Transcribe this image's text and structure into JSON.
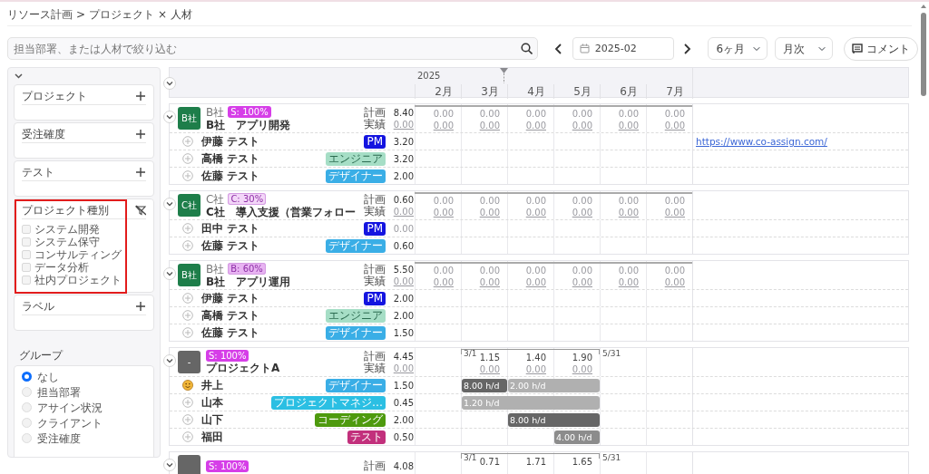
{
  "breadcrumb": {
    "items": [
      "リソース計画",
      "プロジェクト × 人材"
    ],
    "separator": ">"
  },
  "toolbar": {
    "search": {
      "placeholder": "担当部署、または人材で絞り込む"
    },
    "date": "2025-02",
    "range_select": "6ヶ月",
    "interval_select": "月次",
    "comment_button": "コメント"
  },
  "sidebar": {
    "filters": [
      {
        "kind": "add",
        "title": "プロジェクト",
        "highlighted": false
      },
      {
        "kind": "add",
        "title": "受注確度",
        "highlighted": false
      },
      {
        "kind": "add",
        "title": "テスト",
        "highlighted": false
      },
      {
        "kind": "checklist",
        "title": "プロジェクト種別",
        "highlighted": true,
        "options": [
          {
            "label": "システム開発",
            "checked": false
          },
          {
            "label": "システム保守",
            "checked": false
          },
          {
            "label": "コンサルティング",
            "checked": false
          },
          {
            "label": "データ分析",
            "checked": false
          },
          {
            "label": "社内プロジェクト",
            "checked": false
          }
        ]
      },
      {
        "kind": "add",
        "title": "ラベル",
        "highlighted": false
      }
    ],
    "group": {
      "label": "グループ",
      "options": [
        {
          "label": "なし",
          "selected": true
        },
        {
          "label": "担当部署",
          "selected": false
        },
        {
          "label": "アサイン状況",
          "selected": false
        },
        {
          "label": "クライアント",
          "selected": false
        },
        {
          "label": "受注確度",
          "selected": false
        }
      ]
    }
  },
  "timeline": {
    "year": "2025",
    "months": [
      "2月",
      "3月",
      "4月",
      "5月",
      "6月",
      "7月"
    ]
  },
  "projects": [
    {
      "avatar": "B社",
      "color": "#1e7e4a",
      "client": "B社",
      "badge": {
        "text": "S: 100%",
        "color": "#d63ee8"
      },
      "title": "B社　アプリ開発",
      "plan_label": "計画",
      "actual_label": "実績",
      "plan": "8.40",
      "actual": "0.00",
      "months": [
        {
          "kind": "value",
          "plan": "0.00",
          "actual": "0.00"
        },
        {
          "kind": "value",
          "plan": "0.00",
          "actual": "0.00"
        },
        {
          "kind": "value",
          "plan": "0.00",
          "actual": "0.00"
        },
        {
          "kind": "value",
          "plan": "0.00",
          "actual": "0.00"
        },
        {
          "kind": "value",
          "plan": "0.00",
          "actual": "0.00"
        },
        {
          "kind": "value",
          "plan": "0.00",
          "actual": "0.00"
        }
      ],
      "members": [
        {
          "kind": "add",
          "name": "伊藤 テスト",
          "role": {
            "text": "PM",
            "color": "#1414e0"
          },
          "total": "3.20",
          "link": "https://www.co-assign.com/"
        },
        {
          "kind": "add",
          "name": "高橋 テスト",
          "role": {
            "text": "エンジニア",
            "color": "#a6dec6"
          },
          "total": "3.20"
        },
        {
          "kind": "add",
          "name": "佐藤 テスト",
          "role": {
            "text": "デザイナー",
            "color": "#3aaee6"
          },
          "total": "2.00"
        }
      ]
    },
    {
      "avatar": "C社",
      "color": "#1e7e4a",
      "client": "C社",
      "badge": {
        "text": "C: 30%",
        "color": "#f3d6f8"
      },
      "title": "C社　導入支援（営業フォロー",
      "plan_label": "計画",
      "actual_label": "実績",
      "plan": "0.60",
      "actual": "0.00",
      "months": [
        {
          "kind": "value",
          "plan": "0.00",
          "actual": "0.00"
        },
        {
          "kind": "value",
          "plan": "0.00",
          "actual": "0.00"
        },
        {
          "kind": "value",
          "plan": "0.00",
          "actual": "0.00"
        },
        {
          "kind": "value",
          "plan": "0.00",
          "actual": "0.00"
        },
        {
          "kind": "value",
          "plan": "0.00",
          "actual": "0.00"
        },
        {
          "kind": "value",
          "plan": "0.00",
          "actual": "0.00"
        }
      ],
      "members": [
        {
          "kind": "add",
          "name": "田中 テスト",
          "role": {
            "text": "PM",
            "color": "#1414e0"
          },
          "total": "0.00"
        },
        {
          "kind": "add",
          "name": "佐藤 テスト",
          "role": {
            "text": "デザイナー",
            "color": "#3aaee6"
          },
          "total": "0.60"
        }
      ]
    },
    {
      "avatar": "B社",
      "color": "#1e7e4a",
      "client": "B社",
      "badge": {
        "text": "B: 60%",
        "color": "#e8b4f2"
      },
      "title": "B社　アプリ運用",
      "plan_label": "計画",
      "actual_label": "実績",
      "plan": "5.50",
      "actual": "0.00",
      "months": [
        {
          "kind": "value",
          "plan": "0.00",
          "actual": "0.00"
        },
        {
          "kind": "value",
          "plan": "0.00",
          "actual": "0.00"
        },
        {
          "kind": "value",
          "plan": "0.00",
          "actual": "0.00"
        },
        {
          "kind": "value",
          "plan": "0.00",
          "actual": "0.00"
        },
        {
          "kind": "value",
          "plan": "0.00",
          "actual": "0.00"
        },
        {
          "kind": "value",
          "plan": "0.00",
          "actual": "0.00"
        }
      ],
      "members": [
        {
          "kind": "add",
          "name": "伊藤 テスト",
          "role": {
            "text": "PM",
            "color": "#1414e0"
          },
          "total": "2.00"
        },
        {
          "kind": "add",
          "name": "高橋 テスト",
          "role": {
            "text": "エンジニア",
            "color": "#a6dec6"
          },
          "total": "2.00"
        },
        {
          "kind": "add",
          "name": "佐藤 テスト",
          "role": {
            "text": "デザイナー",
            "color": "#3aaee6"
          },
          "total": "1.50"
        }
      ]
    },
    {
      "avatar": "-",
      "color": "#666666",
      "badge": {
        "text": "S: 100%",
        "color": "#d63ee8"
      },
      "title": "プロジェクトA",
      "plan_label": "計画",
      "actual_label": "実績",
      "plan": "4.45",
      "actual": "0.00",
      "range": {
        "start_label": "3/1",
        "end_label": "5/31"
      },
      "months": [
        {
          "kind": "empty"
        },
        {
          "kind": "value",
          "plan": "1.15",
          "actual": "0.00"
        },
        {
          "kind": "value",
          "plan": "1.40",
          "actual": "0.00"
        },
        {
          "kind": "value",
          "plan": "1.90",
          "actual": "0.00"
        },
        {
          "kind": "empty"
        },
        {
          "kind": "empty"
        }
      ],
      "members": [
        {
          "kind": "smiley",
          "name": "井上",
          "role": {
            "text": "デザイナー",
            "color": "#3aaee6"
          },
          "total": "1.50",
          "cells": [
            {
              "kind": "empty"
            },
            {
              "kind": "bar",
              "text": "8.00 h/d",
              "color": "#666666"
            },
            {
              "kind": "bar",
              "text": "2.00 h/d",
              "color": "#b0b0b0"
            },
            {
              "kind": "continue"
            },
            {
              "kind": "empty"
            },
            {
              "kind": "empty"
            }
          ]
        },
        {
          "kind": "add",
          "name": "山本",
          "role": {
            "text": "プロジェクトマネジ…",
            "color": "#2bbfe3"
          },
          "total": "0.45",
          "cells": [
            {
              "kind": "empty"
            },
            {
              "kind": "bar",
              "text": "1.20 h/d",
              "color": "#b0b0b0"
            },
            {
              "kind": "continue"
            },
            {
              "kind": "continue"
            },
            {
              "kind": "empty"
            },
            {
              "kind": "empty"
            }
          ]
        },
        {
          "kind": "add",
          "name": "山下",
          "role": {
            "text": "コーディング",
            "color": "#4e9a0e"
          },
          "total": "2.00",
          "cells": [
            {
              "kind": "empty"
            },
            {
              "kind": "empty"
            },
            {
              "kind": "bar",
              "text": "8.00 h/d",
              "color": "#666666"
            },
            {
              "kind": "continue"
            },
            {
              "kind": "empty"
            },
            {
              "kind": "empty"
            }
          ]
        },
        {
          "kind": "add",
          "name": "福田",
          "role": {
            "text": "テスト",
            "color": "#c2307c"
          },
          "total": "0.50",
          "cells": [
            {
              "kind": "empty"
            },
            {
              "kind": "empty"
            },
            {
              "kind": "empty"
            },
            {
              "kind": "bar",
              "text": "4.00 h/d",
              "color": "#8c8c8c"
            },
            {
              "kind": "empty"
            },
            {
              "kind": "empty"
            }
          ]
        }
      ]
    },
    {
      "color": "#666666",
      "badge": {
        "text": "S: 100%",
        "color": "#d63ee8"
      },
      "plan_label": "計画",
      "plan": "4.08",
      "range": {
        "start_label": "3/1",
        "end_label": "5/31"
      },
      "months": [
        {
          "kind": "empty"
        },
        {
          "kind": "value",
          "plan": "0.71"
        },
        {
          "kind": "value",
          "plan": "1.71"
        },
        {
          "kind": "value",
          "plan": "1.65"
        },
        {
          "kind": "empty"
        },
        {
          "kind": "empty"
        }
      ]
    }
  ]
}
